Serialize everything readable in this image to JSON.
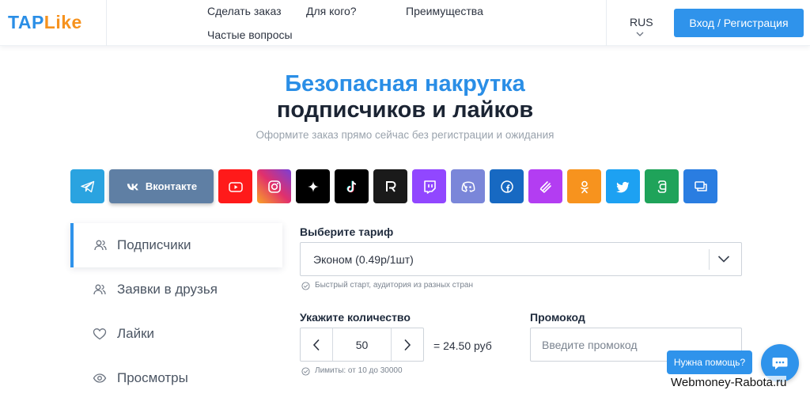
{
  "header": {
    "logo_part1": "TAP",
    "logo_part2": "Like",
    "nav": [
      "Сделать заказ",
      "Для кого?",
      "Преимущества",
      "Частые вопросы"
    ],
    "lang": "RUS",
    "login_label": "Вход / Регистрация"
  },
  "hero": {
    "title_line1": "Безопасная накрутка",
    "title_line2": "подписчиков и лайков",
    "subtitle": "Оформите заказ прямо сейчас без регистрации и ожидания"
  },
  "platforms": [
    {
      "id": "telegram",
      "icon": "telegram-icon",
      "color": "#2aa3e0"
    },
    {
      "id": "vk",
      "icon": "vk-icon",
      "color": "#5f7fa4",
      "label": "Вконтакте"
    },
    {
      "id": "youtube",
      "icon": "youtube-icon",
      "color": "#ff1a1a"
    },
    {
      "id": "instagram",
      "icon": "instagram-icon",
      "color": "#d52c88"
    },
    {
      "id": "threads",
      "icon": "sparkle-icon",
      "color": "#000000"
    },
    {
      "id": "tiktok",
      "icon": "tiktok-icon",
      "color": "#000000"
    },
    {
      "id": "rutube",
      "icon": "rutube-icon",
      "color": "#1a1a1a"
    },
    {
      "id": "twitch",
      "icon": "twitch-icon",
      "color": "#9147ff"
    },
    {
      "id": "discord",
      "icon": "discord-icon",
      "color": "#7a86d9"
    },
    {
      "id": "facebook",
      "icon": "facebook-icon",
      "color": "#1769c2"
    },
    {
      "id": "likee",
      "icon": "likee-icon",
      "color": "#b33df2"
    },
    {
      "id": "odnoklassniki",
      "icon": "odnoklassniki-icon",
      "color": "#f7931e"
    },
    {
      "id": "twitter",
      "icon": "twitter-icon",
      "color": "#1da1f2"
    },
    {
      "id": "dzen",
      "icon": "dzen-icon",
      "color": "#1fa35a"
    },
    {
      "id": "other",
      "icon": "chat-windows-icon",
      "color": "#2a7de1"
    }
  ],
  "menu": [
    {
      "label": "Подписчики",
      "icon": "users-icon",
      "active": true
    },
    {
      "label": "Заявки в друзья",
      "icon": "users-icon",
      "active": false
    },
    {
      "label": "Лайки",
      "icon": "heart-icon",
      "active": false
    },
    {
      "label": "Просмотры",
      "icon": "eye-icon",
      "active": false
    }
  ],
  "form": {
    "tariff_label": "Выберите тариф",
    "tariff_value": "Эконом (0.49р/1шт)",
    "tariff_hint": "Быстрый старт, аудитория из разных стран",
    "quantity_label": "Укажите количество",
    "quantity_value": "50",
    "price": "= 24.50 руб",
    "limit_hint": "Лимиты: от 10 до 30000",
    "promo_label": "Промокод",
    "promo_placeholder": "Введите промокод"
  },
  "help": {
    "bubble_label": "Нужна помощь?"
  },
  "watermark": "Webmoney-Rabota.ru",
  "colors": {
    "accent": "#2f93eb",
    "logo_orange": "#f6921e",
    "text_dark": "#1f2b3d"
  }
}
